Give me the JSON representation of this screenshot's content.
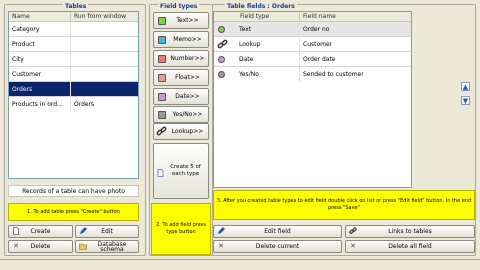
{
  "tables": {
    "title": "Tables",
    "columns": [
      "Name",
      "Run from window"
    ],
    "rows": [
      {
        "name": "Category",
        "run": ""
      },
      {
        "name": "Product",
        "run": ""
      },
      {
        "name": "City",
        "run": ""
      },
      {
        "name": "Customer",
        "run": ""
      },
      {
        "name": "Orders",
        "run": "",
        "selected": true
      },
      {
        "name": "Products in ord...",
        "run": "Orders"
      }
    ],
    "photo_note": "Records of a table can have photo",
    "hint": "1. To add table press \"Create\" button",
    "create_label": "Create",
    "edit_label": "Edit",
    "delete_label": "Delete",
    "schema_label": "Database schema"
  },
  "field_types": {
    "title": "Field types",
    "items": [
      {
        "label": "Text>>",
        "color": "#7fd13b"
      },
      {
        "label": "Memo>>",
        "color": "#3fb8e0"
      },
      {
        "label": "Number>>",
        "color": "#f07878"
      },
      {
        "label": "Float>>",
        "color": "#f09a9a"
      },
      {
        "label": "Date>>",
        "color": "#c79ad6"
      },
      {
        "label": "Yes/No>>",
        "color": "#9a9a9a"
      },
      {
        "label": "Lookup>>",
        "color": ""
      }
    ],
    "create5_label": "Create 5 of each type",
    "hint": "2. To add field press type button"
  },
  "table_fields": {
    "title": "Table fields : Orders",
    "columns": [
      "Field type",
      "Field name"
    ],
    "rows": [
      {
        "type": "Text",
        "name": "Order no",
        "color": "#7fd13b",
        "icon": "dot-icon",
        "highlighted": true
      },
      {
        "type": "Lookup",
        "name": "Customer",
        "color": "",
        "icon": "link-icon"
      },
      {
        "type": "Date",
        "name": "Order date",
        "color": "#c79ad6",
        "icon": "dot-icon"
      },
      {
        "type": "Yes/No",
        "name": "Sended to customer",
        "color": "#9a9a9a",
        "icon": "dot-icon"
      }
    ],
    "hint": "3. After you created table types to edit field double click on list or press \"Edit field\" button. In the end press \"Save\"",
    "edit_field_label": "Edit field",
    "links_label": "Links to tables",
    "delete_current_label": "Delete current",
    "delete_all_label": "Delete all field"
  }
}
